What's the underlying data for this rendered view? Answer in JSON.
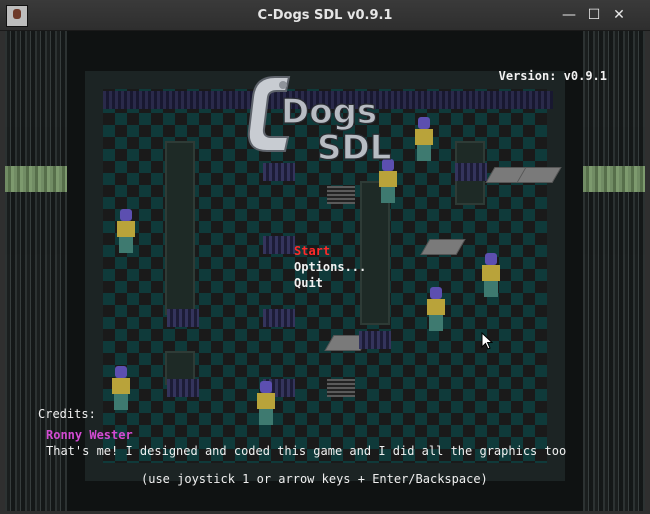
{
  "window": {
    "title": "C-Dogs SDL v0.9.1",
    "buttons": {
      "minimize": "—",
      "maximize": "☐",
      "close": "✕"
    }
  },
  "game": {
    "version": "Version: v0.9.1",
    "logo": {
      "line1": "Dogs",
      "line2": "SDL",
      "letter": "C"
    },
    "menu": [
      {
        "label": "Start",
        "selected": true
      },
      {
        "label": "Options...",
        "selected": false
      },
      {
        "label": "Quit",
        "selected": false
      }
    ],
    "credits": {
      "heading": "Credits:",
      "name": "Ronny Wester",
      "text": "That's me! I designed and coded this game and I did all the graphics too"
    },
    "hint": "(use joystick 1 or arrow keys + Enter/Backspace)"
  },
  "colors": {
    "selected": "#ff2a2a",
    "credit_name": "#d24bd2",
    "text": "#f0f0f0"
  }
}
